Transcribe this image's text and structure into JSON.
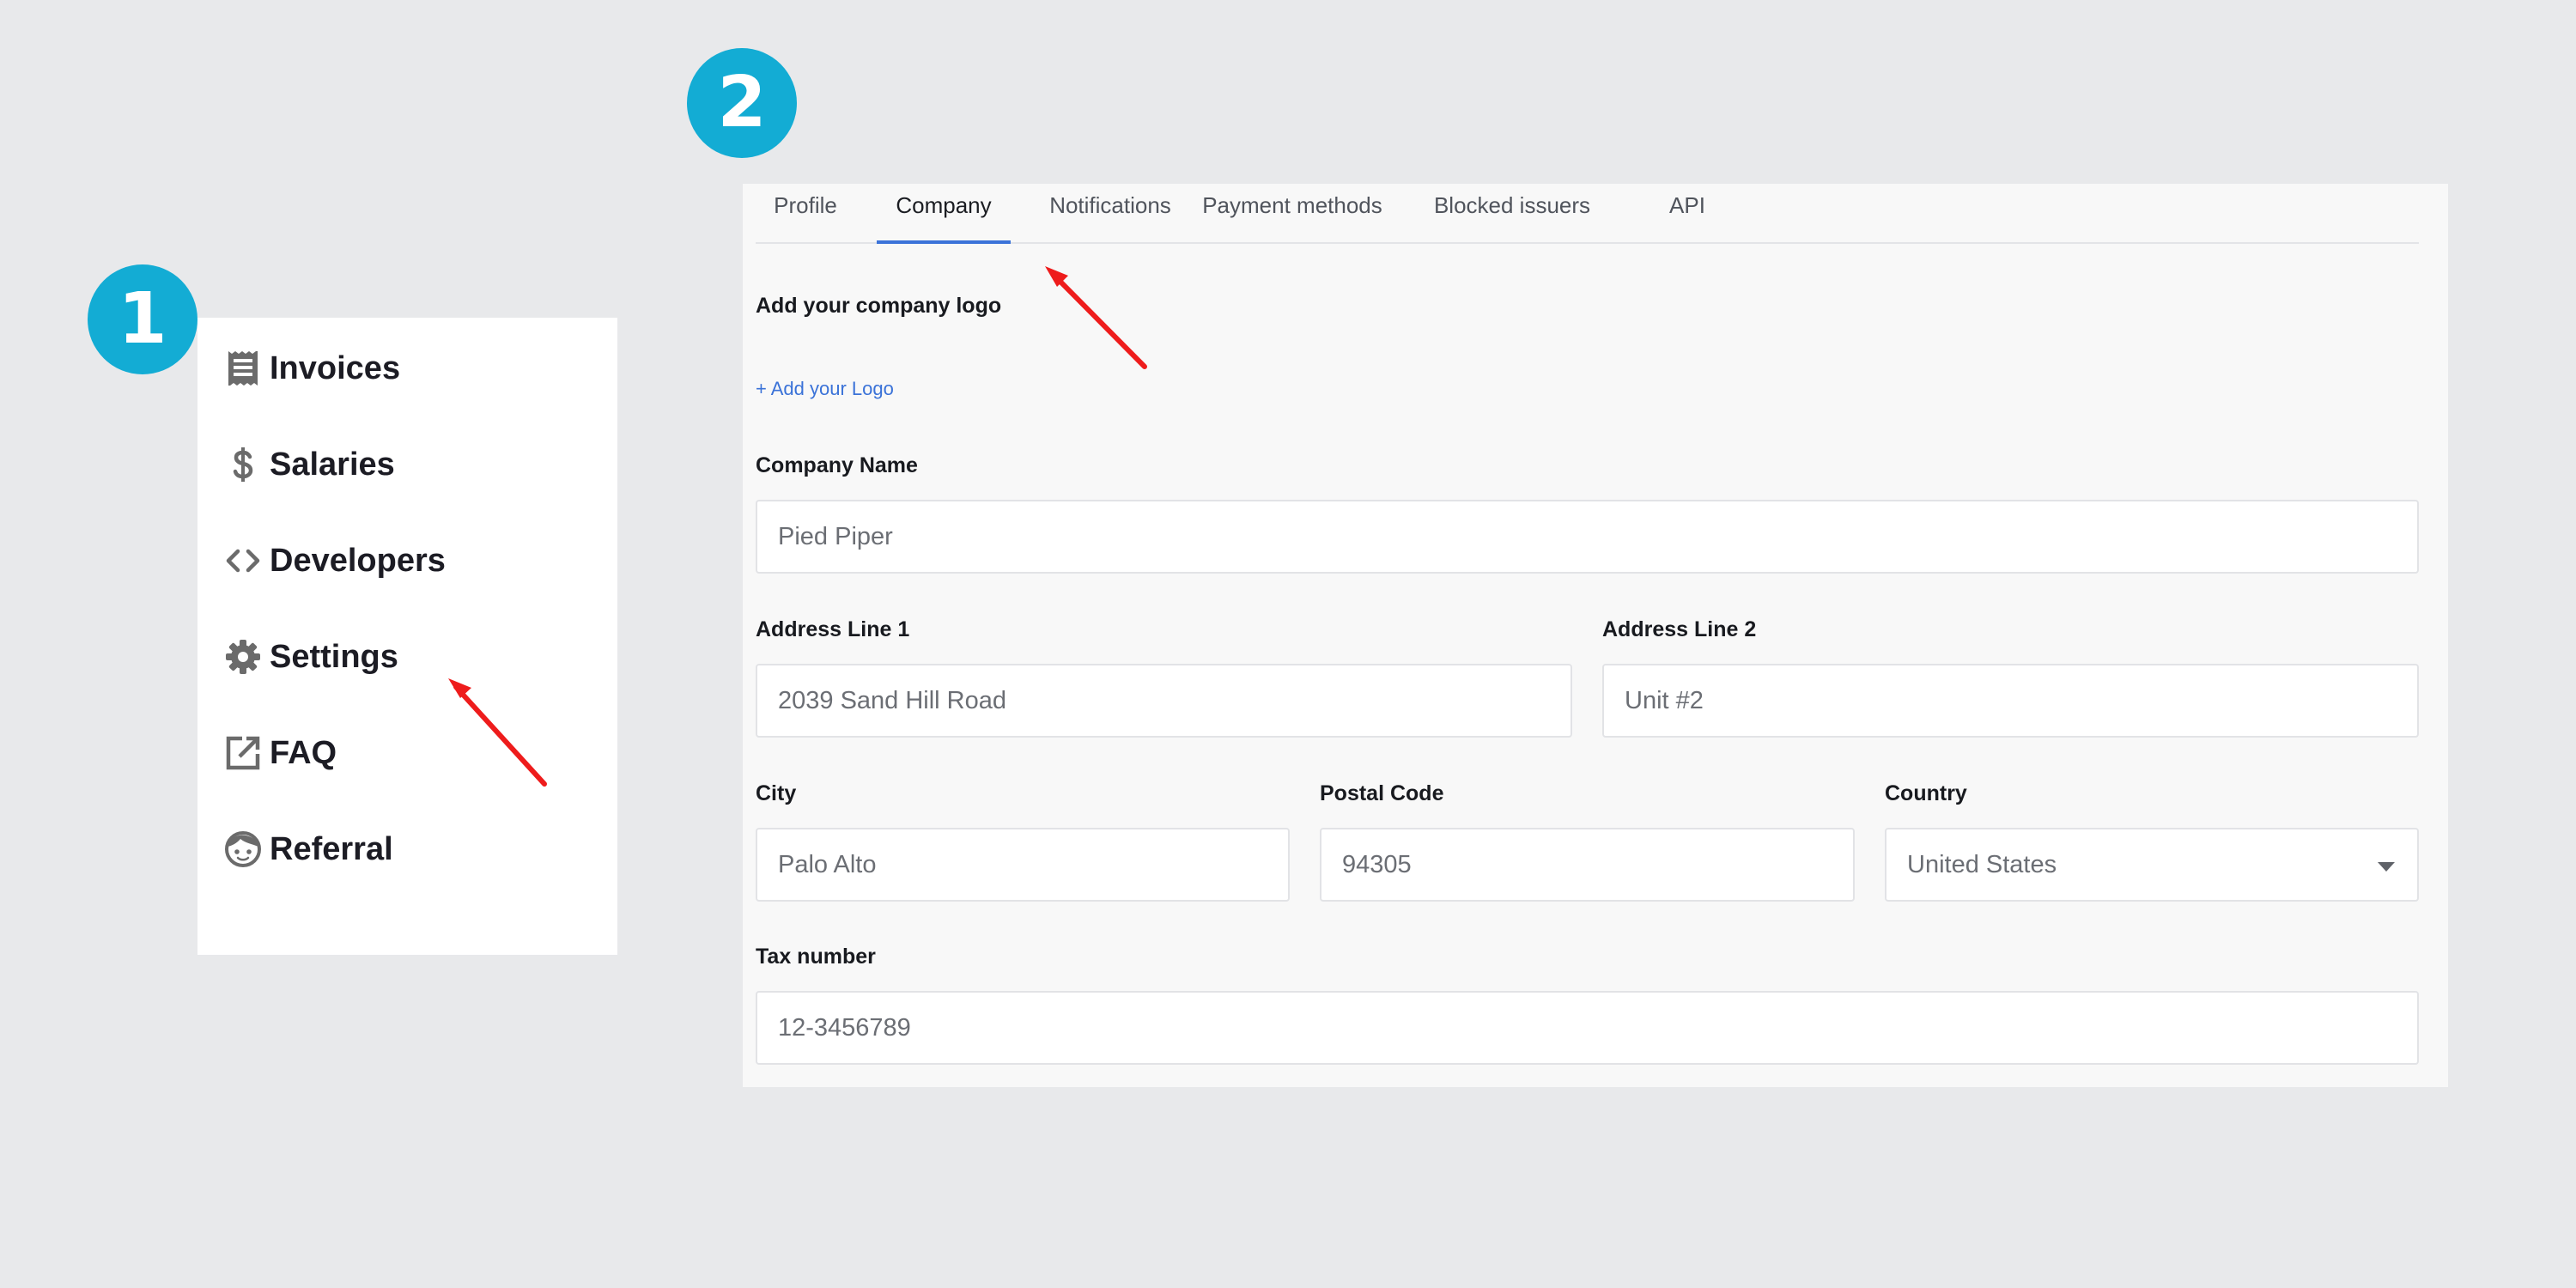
{
  "badges": {
    "step1": "1",
    "step2": "2"
  },
  "sidebar": {
    "items": [
      {
        "label": "Invoices",
        "icon": "invoice-icon"
      },
      {
        "label": "Salaries",
        "icon": "dollar-icon"
      },
      {
        "label": "Developers",
        "icon": "code-icon"
      },
      {
        "label": "Settings",
        "icon": "gear-icon"
      },
      {
        "label": "FAQ",
        "icon": "external-link-icon"
      },
      {
        "label": "Referral",
        "icon": "face-icon"
      }
    ]
  },
  "settings": {
    "tabs": [
      {
        "label": "Profile",
        "active": false
      },
      {
        "label": "Company",
        "active": true
      },
      {
        "label": "Notifications",
        "active": false
      },
      {
        "label": "Payment methods",
        "active": false
      },
      {
        "label": "Blocked issuers",
        "active": false
      },
      {
        "label": "API",
        "active": false
      }
    ],
    "logo_heading": "Add your company logo",
    "add_logo_link": "+ Add your Logo",
    "company_name": {
      "label": "Company Name",
      "value": "Pied Piper"
    },
    "address1": {
      "label": "Address Line 1",
      "value": "2039 Sand Hill Road"
    },
    "address2": {
      "label": "Address Line 2",
      "value": "Unit #2"
    },
    "city": {
      "label": "City",
      "value": "Palo Alto"
    },
    "postal": {
      "label": "Postal Code",
      "value": "94305"
    },
    "country": {
      "label": "Country",
      "value": "United States"
    },
    "tax": {
      "label": "Tax number",
      "value": "12-3456789"
    }
  },
  "colors": {
    "badge": "#13acd4",
    "accent": "#3b73d9",
    "arrow": "#ee1c1c"
  }
}
